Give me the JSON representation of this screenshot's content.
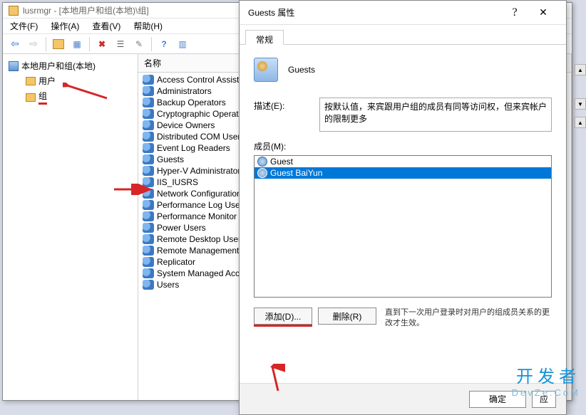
{
  "mmc": {
    "title": "lusrmgr - [本地用户和组(本地)\\组]",
    "menus": {
      "file": "文件(F)",
      "action": "操作(A)",
      "view": "查看(V)",
      "help": "帮助(H)"
    },
    "tree": {
      "root": "本地用户和组(本地)",
      "children": [
        {
          "label": "用户"
        },
        {
          "label": "组"
        }
      ]
    },
    "list": {
      "header": "名称",
      "items": [
        "Access Control Assistance Operators",
        "Administrators",
        "Backup Operators",
        "Cryptographic Operators",
        "Device Owners",
        "Distributed COM Users",
        "Event Log Readers",
        "Guests",
        "Hyper-V Administrators",
        "IIS_IUSRS",
        "Network Configuration Operators",
        "Performance Log Users",
        "Performance Monitor Users",
        "Power Users",
        "Remote Desktop Users",
        "Remote Management Users",
        "Replicator",
        "System Managed Accounts Group",
        "Users"
      ],
      "selected_index": 7
    }
  },
  "dialog": {
    "title": "Guests 属性",
    "help": "?",
    "close": "✕",
    "tab": "常规",
    "group_name": "Guests",
    "desc_label": "描述(E):",
    "desc_value": "按默认值，来宾跟用户组的成员有同等访问权，但来宾帐户的限制更多",
    "members_label": "成员(M):",
    "members": [
      {
        "name": "Guest",
        "selected": false
      },
      {
        "name": "Guest BaiYun",
        "selected": true
      }
    ],
    "add_btn": "添加(D)...",
    "remove_btn": "删除(R)",
    "note": "直到下一次用户登录时对用户的组成员关系的更改才生效。",
    "ok": "确定",
    "apply": "应"
  },
  "watermark": {
    "line1": "开发者",
    "line2": "DevZe.CoM"
  }
}
